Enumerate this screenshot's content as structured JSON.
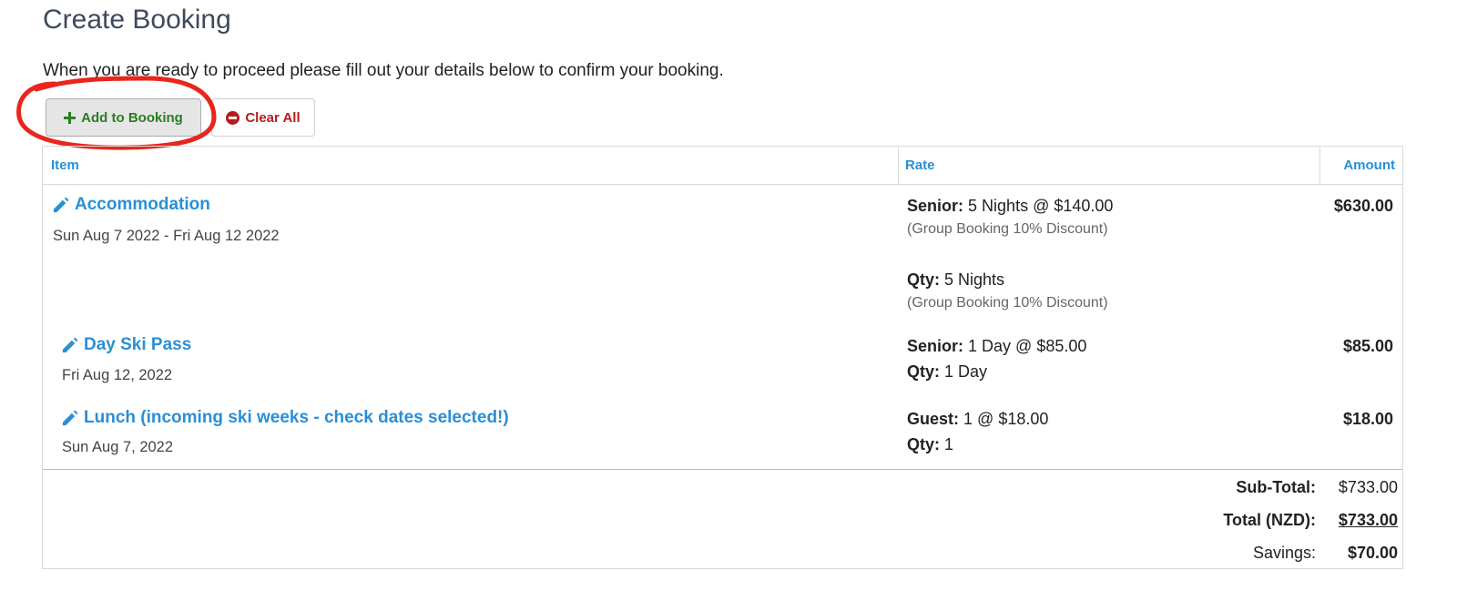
{
  "page": {
    "title": "Create Booking",
    "intro": "When you are ready to proceed please fill out your details below to confirm your booking."
  },
  "toolbar": {
    "add_label": "Add to Booking",
    "clear_label": "Clear All"
  },
  "table": {
    "headers": {
      "item": "Item",
      "rate": "Rate",
      "amount": "Amount"
    },
    "rows": [
      {
        "item": "Accommodation",
        "date": "Sun Aug 7 2022 - Fri Aug 12 2022",
        "rate_lines": [
          {
            "label": "Senior:",
            "value": "5 Nights @ $140.00",
            "note": "(Group Booking 10% Discount)"
          },
          {
            "label": "Qty:",
            "value": "5 Nights",
            "note": "(Group Booking 10% Discount)"
          }
        ],
        "amount": "$630.00"
      },
      {
        "item": "Day Ski Pass",
        "date": "Fri Aug 12, 2022",
        "rate_lines": [
          {
            "label": "Senior:",
            "value": "1 Day @ $85.00"
          },
          {
            "label": "Qty:",
            "value": "1 Day"
          }
        ],
        "amount": "$85.00"
      },
      {
        "item": "Lunch (incoming ski weeks - check dates selected!)",
        "date": "Sun Aug 7, 2022",
        "rate_lines": [
          {
            "label": "Guest:",
            "value": "1 @ $18.00"
          },
          {
            "label": "Qty:",
            "value": "1"
          }
        ],
        "amount": "$18.00"
      }
    ],
    "totals": {
      "subtotal_label": "Sub-Total:",
      "subtotal": "$733.00",
      "total_label": "Total (NZD):",
      "total": "$733.00",
      "savings_label": "Savings:",
      "savings": "$70.00"
    }
  },
  "colors": {
    "link": "#2a8fd6",
    "add_green": "#2a7d22",
    "clear_red": "#b71c1c",
    "annotation_red": "#e8261c"
  },
  "icons": [
    "plus-icon",
    "minus-circle-icon",
    "pencil-icon"
  ]
}
